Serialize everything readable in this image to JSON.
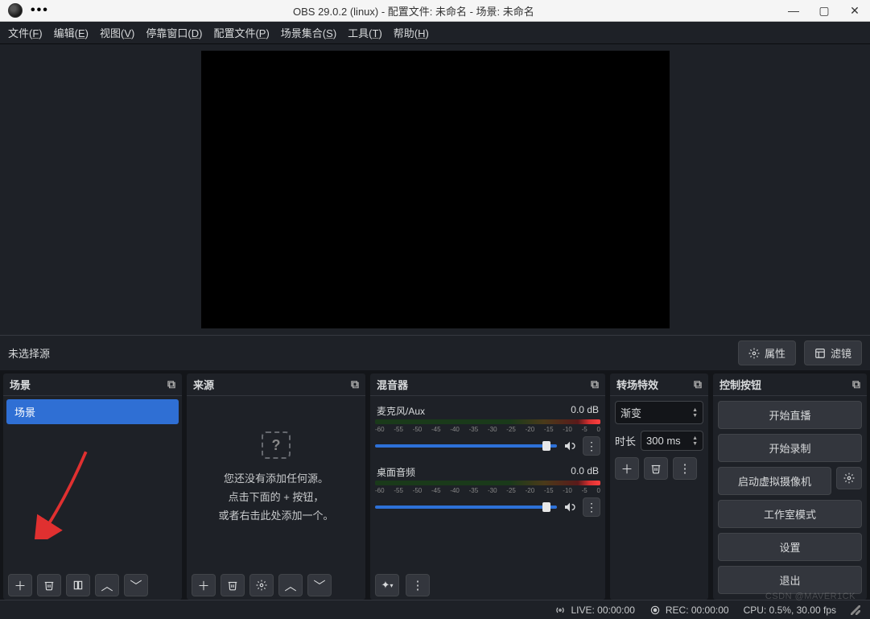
{
  "titlebar": {
    "dots": "•••",
    "title": "OBS 29.0.2 (linux) - 配置文件: 未命名 - 场景: 未命名"
  },
  "menubar": {
    "file": "文件(",
    "file_u": "F",
    "file_e": ")",
    "edit": "编辑(",
    "edit_u": "E",
    "edit_e": ")",
    "view": "视图(",
    "view_u": "V",
    "view_e": ")",
    "dock": "停靠窗口(",
    "dock_u": "D",
    "dock_e": ")",
    "profile": "配置文件(",
    "profile_u": "P",
    "profile_e": ")",
    "scenecol": "场景集合(",
    "scenecol_u": "S",
    "scenecol_e": ")",
    "tools": "工具(",
    "tools_u": "T",
    "tools_e": ")",
    "help": "帮助(",
    "help_u": "H",
    "help_e": ")"
  },
  "toolbar": {
    "no_source": "未选择源",
    "properties": "属性",
    "filters": "滤镜"
  },
  "panels": {
    "scenes": {
      "title": "场景",
      "item": "场景"
    },
    "sources": {
      "title": "来源",
      "empty1": "您还没有添加任何源。",
      "empty2": "点击下面的 + 按钮，",
      "empty3": "或者右击此处添加一个。"
    },
    "mixer": {
      "title": "混音器",
      "mic_label": "麦克风/Aux",
      "mic_db": "0.0 dB",
      "desktop_label": "桌面音频",
      "desktop_db": "0.0 dB",
      "ticks": [
        "-60",
        "-55",
        "-50",
        "-45",
        "-40",
        "-35",
        "-30",
        "-25",
        "-20",
        "-15",
        "-10",
        "-5",
        "0"
      ]
    },
    "transition": {
      "title": "转场特效",
      "type": "渐变",
      "dur_label": "时长",
      "dur_value": "300 ms"
    },
    "controls": {
      "title": "控制按钮",
      "stream": "开始直播",
      "record": "开始录制",
      "virtcam": "启动虚拟摄像机",
      "studio": "工作室模式",
      "settings": "设置",
      "exit": "退出"
    }
  },
  "statusbar": {
    "live": "LIVE: 00:00:00",
    "rec": "REC: 00:00:00",
    "cpu": "CPU: 0.5%, 30.00 fps"
  },
  "watermark": "CSDN @MAVER1CK"
}
